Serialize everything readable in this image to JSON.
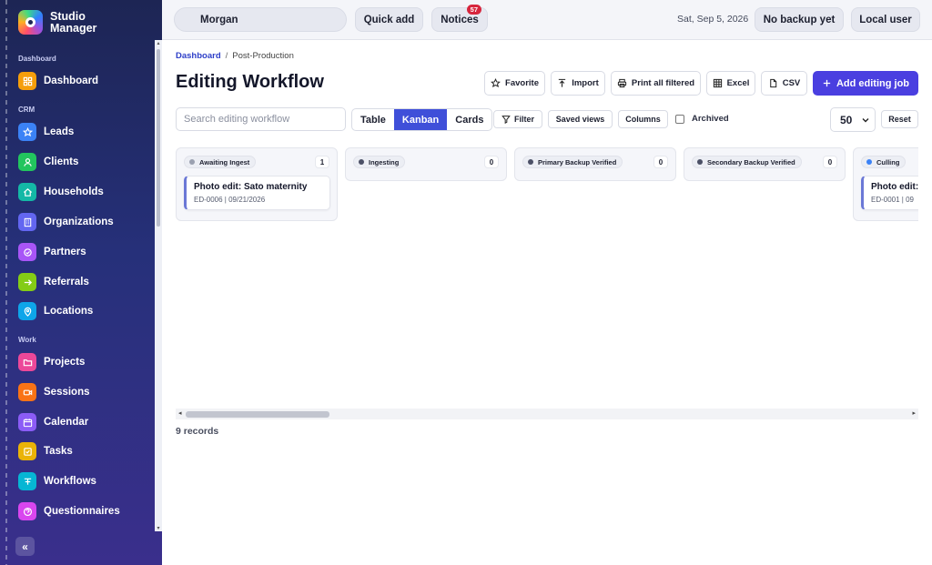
{
  "app": {
    "name_line1": "Studio",
    "name_line2": "Manager"
  },
  "sidebar": {
    "sections": [
      {
        "label": "Dashboard",
        "items": [
          {
            "label": "Dashboard",
            "icon": "grid-icon",
            "color": "#f59e0b"
          }
        ]
      },
      {
        "label": "CRM",
        "items": [
          {
            "label": "Leads",
            "icon": "star-icon",
            "color": "#3b82f6"
          },
          {
            "label": "Clients",
            "icon": "person-icon",
            "color": "#22c55e"
          },
          {
            "label": "Households",
            "icon": "home-icon",
            "color": "#14b8a6"
          },
          {
            "label": "Organizations",
            "icon": "building-icon",
            "color": "#6366f1"
          },
          {
            "label": "Partners",
            "icon": "handshake-icon",
            "color": "#a855f7"
          },
          {
            "label": "Referrals",
            "icon": "arrow-right-icon",
            "color": "#84cc16"
          },
          {
            "label": "Locations",
            "icon": "pin-icon",
            "color": "#0ea5e9"
          }
        ]
      },
      {
        "label": "Work",
        "items": [
          {
            "label": "Projects",
            "icon": "folder-icon",
            "color": "#ec4899"
          },
          {
            "label": "Sessions",
            "icon": "video-icon",
            "color": "#f97316"
          },
          {
            "label": "Calendar",
            "icon": "calendar-icon",
            "color": "#8b5cf6"
          },
          {
            "label": "Tasks",
            "icon": "checkbox-icon",
            "color": "#eab308"
          },
          {
            "label": "Workflows",
            "icon": "workflow-icon",
            "color": "#06b6d4"
          },
          {
            "label": "Questionnaires",
            "icon": "question-icon",
            "color": "#d946ef"
          }
        ]
      }
    ],
    "collapse_label": "«"
  },
  "topbar": {
    "user": "Morgan",
    "quick_add": "Quick add",
    "notices": "Notices",
    "notices_count": "57",
    "date": "Sat, Sep 5, 2026",
    "backup": "No backup yet",
    "local_user": "Local user"
  },
  "breadcrumb": {
    "home": "Dashboard",
    "sep": "/",
    "current": "Post-Production"
  },
  "page": {
    "title": "Editing Workflow"
  },
  "toolbar": {
    "favorite": "Favorite",
    "import": "Import",
    "print": "Print all filtered",
    "excel": "Excel",
    "csv": "CSV",
    "add": "Add editing job"
  },
  "filters": {
    "search_placeholder": "Search editing workflow",
    "views": [
      "Table",
      "Kanban",
      "Cards"
    ],
    "active_view": "Kanban",
    "filter": "Filter",
    "saved_views": "Saved views",
    "columns": "Columns",
    "archived": "Archived",
    "page_size": "50",
    "reset": "Reset"
  },
  "kanban": {
    "columns": [
      {
        "name": "Awaiting Ingest",
        "count": "1",
        "dot": "#9aa0b0",
        "cards": [
          {
            "title": "Photo edit: Sato maternity",
            "meta": "ED-0006 | 09/21/2026"
          }
        ]
      },
      {
        "name": "Ingesting",
        "count": "0",
        "dot": "#4b5066",
        "cards": []
      },
      {
        "name": "Primary Backup Verified",
        "count": "0",
        "dot": "#4b5066",
        "cards": []
      },
      {
        "name": "Secondary Backup Verified",
        "count": "0",
        "dot": "#4b5066",
        "cards": []
      },
      {
        "name": "Culling",
        "count": "",
        "dot": "#3b82f6",
        "cards": [
          {
            "title": "Photo edit:",
            "meta": "ED-0001 | 09"
          }
        ]
      }
    ]
  },
  "footer": {
    "records": "9 records"
  }
}
